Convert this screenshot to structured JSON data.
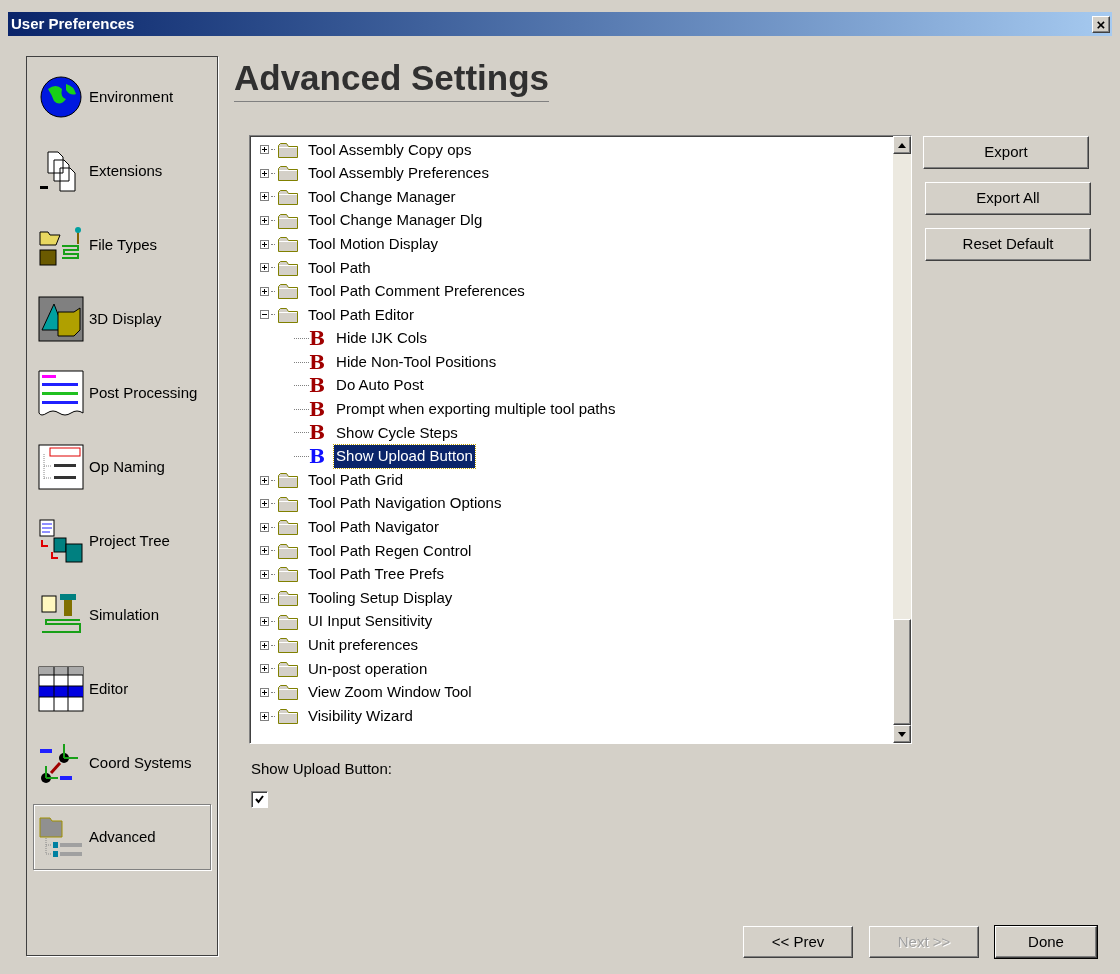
{
  "window": {
    "title": "User Preferences",
    "close": "×"
  },
  "sidebar": {
    "items": [
      {
        "label": "Environment",
        "selected": false
      },
      {
        "label": "Extensions",
        "selected": false
      },
      {
        "label": "File Types",
        "selected": false
      },
      {
        "label": "3D Display",
        "selected": false
      },
      {
        "label": "Post Processing",
        "selected": false
      },
      {
        "label": "Op Naming",
        "selected": false
      },
      {
        "label": "Project Tree",
        "selected": false
      },
      {
        "label": "Simulation",
        "selected": false
      },
      {
        "label": "Editor",
        "selected": false
      },
      {
        "label": "Coord Systems",
        "selected": false
      },
      {
        "label": "Advanced",
        "selected": true
      }
    ]
  },
  "heading": "Advanced Settings",
  "tree": {
    "items": [
      {
        "label": "Tool Assembly Copy ops",
        "expanded": false
      },
      {
        "label": "Tool Assembly Preferences",
        "expanded": false
      },
      {
        "label": "Tool Change Manager",
        "expanded": false
      },
      {
        "label": "Tool Change Manager Dlg",
        "expanded": false
      },
      {
        "label": "Tool Motion Display",
        "expanded": false
      },
      {
        "label": "Tool Path",
        "expanded": false
      },
      {
        "label": "Tool Path Comment Preferences",
        "expanded": false
      },
      {
        "label": "Tool Path Editor",
        "expanded": true,
        "children": [
          {
            "glyph": "B",
            "label": "Hide IJK Cols",
            "selected": false
          },
          {
            "glyph": "B",
            "label": "Hide Non-Tool Positions",
            "selected": false
          },
          {
            "glyph": "B",
            "label": "Do Auto Post",
            "selected": false
          },
          {
            "glyph": "B",
            "label": "Prompt when exporting multiple tool paths",
            "selected": false
          },
          {
            "glyph": "B",
            "label": "Show Cycle Steps",
            "selected": false
          },
          {
            "glyph": "B",
            "label": "Show Upload Button",
            "selected": true
          }
        ]
      },
      {
        "label": "Tool Path Grid",
        "expanded": false
      },
      {
        "label": "Tool Path Navigation Options",
        "expanded": false
      },
      {
        "label": "Tool Path Navigator",
        "expanded": false
      },
      {
        "label": "Tool Path Regen Control",
        "expanded": false
      },
      {
        "label": "Tool Path Tree Prefs",
        "expanded": false
      },
      {
        "label": "Tooling Setup Display",
        "expanded": false
      },
      {
        "label": "UI Input Sensitivity",
        "expanded": false
      },
      {
        "label": "Unit preferences",
        "expanded": false
      },
      {
        "label": "Un-post operation",
        "expanded": false
      },
      {
        "label": "View Zoom Window Tool",
        "expanded": false
      },
      {
        "label": "Visibility Wizard",
        "expanded": false
      }
    ]
  },
  "side_buttons": [
    "Export",
    "Export All",
    "Reset Default"
  ],
  "setting": {
    "label": "Show Upload Button:",
    "checked": true
  },
  "footer_buttons": [
    {
      "label": "<< Prev",
      "disabled": false,
      "default": false
    },
    {
      "label": "Next >>",
      "disabled": true,
      "default": false
    },
    {
      "label": "Done",
      "disabled": false,
      "default": true
    }
  ]
}
